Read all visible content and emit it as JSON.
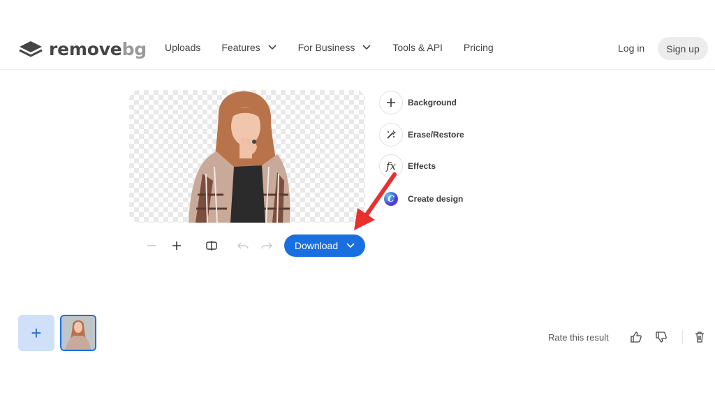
{
  "brand": {
    "name_main": "remove",
    "name_accent": "bg"
  },
  "nav": {
    "items": [
      {
        "label": "Uploads",
        "has_dropdown": false
      },
      {
        "label": "Features",
        "has_dropdown": true
      },
      {
        "label": "For Business",
        "has_dropdown": true
      },
      {
        "label": "Tools & API",
        "has_dropdown": false
      },
      {
        "label": "Pricing",
        "has_dropdown": false
      }
    ],
    "login": "Log in",
    "signup": "Sign up"
  },
  "editor": {
    "tools": [
      {
        "icon": "plus-icon",
        "label": "Background"
      },
      {
        "icon": "magic-brush-icon",
        "label": "Erase/Restore"
      },
      {
        "icon": "fx-icon",
        "label": "Effects"
      },
      {
        "icon": "canva-logo-icon",
        "label": "Create design"
      }
    ],
    "controls": {
      "zoom_out": "−",
      "zoom_in": "+",
      "compare_icon": "compare-icon",
      "undo_icon": "undo-icon",
      "redo_icon": "redo-icon"
    },
    "download_label": "Download",
    "fx_glyph": "fx",
    "canva_glyph": "C"
  },
  "footer": {
    "add_symbol": "+",
    "rate_label": "Rate this result"
  },
  "colors": {
    "accent": "#1a6fe0",
    "arrow": "#e8302e",
    "text": "#454545"
  }
}
